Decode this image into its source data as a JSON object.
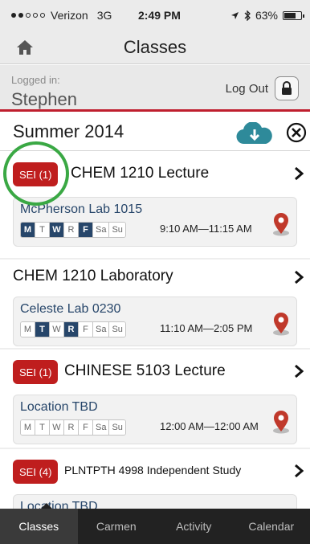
{
  "status": {
    "carrier": "Verizon",
    "network": "3G",
    "time": "2:49 PM",
    "battery": "63%"
  },
  "nav": {
    "title": "Classes",
    "home_icon": "home-icon"
  },
  "login": {
    "label": "Logged in:",
    "user": "Stephen",
    "logout": "Log Out"
  },
  "term": {
    "title": "Summer 2014"
  },
  "courses": [
    {
      "badge": "SEI (1)",
      "title": "CHEM 1210 Lecture",
      "location": "McPherson Lab 1015",
      "days": [
        {
          "d": "M",
          "on": true
        },
        {
          "d": "T",
          "on": false
        },
        {
          "d": "W",
          "on": true
        },
        {
          "d": "R",
          "on": false
        },
        {
          "d": "F",
          "on": true
        },
        {
          "d": "Sa",
          "on": false
        },
        {
          "d": "Su",
          "on": false
        }
      ],
      "time": "9:10 AM—11:15 AM"
    },
    {
      "badge": "",
      "title": "CHEM 1210 Laboratory",
      "location": "Celeste Lab 0230",
      "days": [
        {
          "d": "M",
          "on": false
        },
        {
          "d": "T",
          "on": true
        },
        {
          "d": "W",
          "on": false
        },
        {
          "d": "R",
          "on": true
        },
        {
          "d": "F",
          "on": false
        },
        {
          "d": "Sa",
          "on": false
        },
        {
          "d": "Su",
          "on": false
        }
      ],
      "time": "11:10 AM—2:05 PM"
    },
    {
      "badge": "SEI (1)",
      "title": "CHINESE 5103 Lecture",
      "location": "Location TBD",
      "days": [
        {
          "d": "M",
          "on": false
        },
        {
          "d": "T",
          "on": false
        },
        {
          "d": "W",
          "on": false
        },
        {
          "d": "R",
          "on": false
        },
        {
          "d": "F",
          "on": false
        },
        {
          "d": "Sa",
          "on": false
        },
        {
          "d": "Su",
          "on": false
        }
      ],
      "time": "12:00 AM—12:00 AM"
    },
    {
      "badge": "SEI (4)",
      "title": "PLNTPTH 4998 Independent Study",
      "location": "Location TBD",
      "days": [],
      "time": ""
    }
  ],
  "tabs": [
    "Classes",
    "Carmen",
    "Activity",
    "Calendar"
  ],
  "colors": {
    "accent": "#bf1e2e",
    "badge": "#bf1e1e",
    "navy": "#27466a",
    "cloud": "#2e8a9a",
    "highlight": "#3aa844"
  }
}
